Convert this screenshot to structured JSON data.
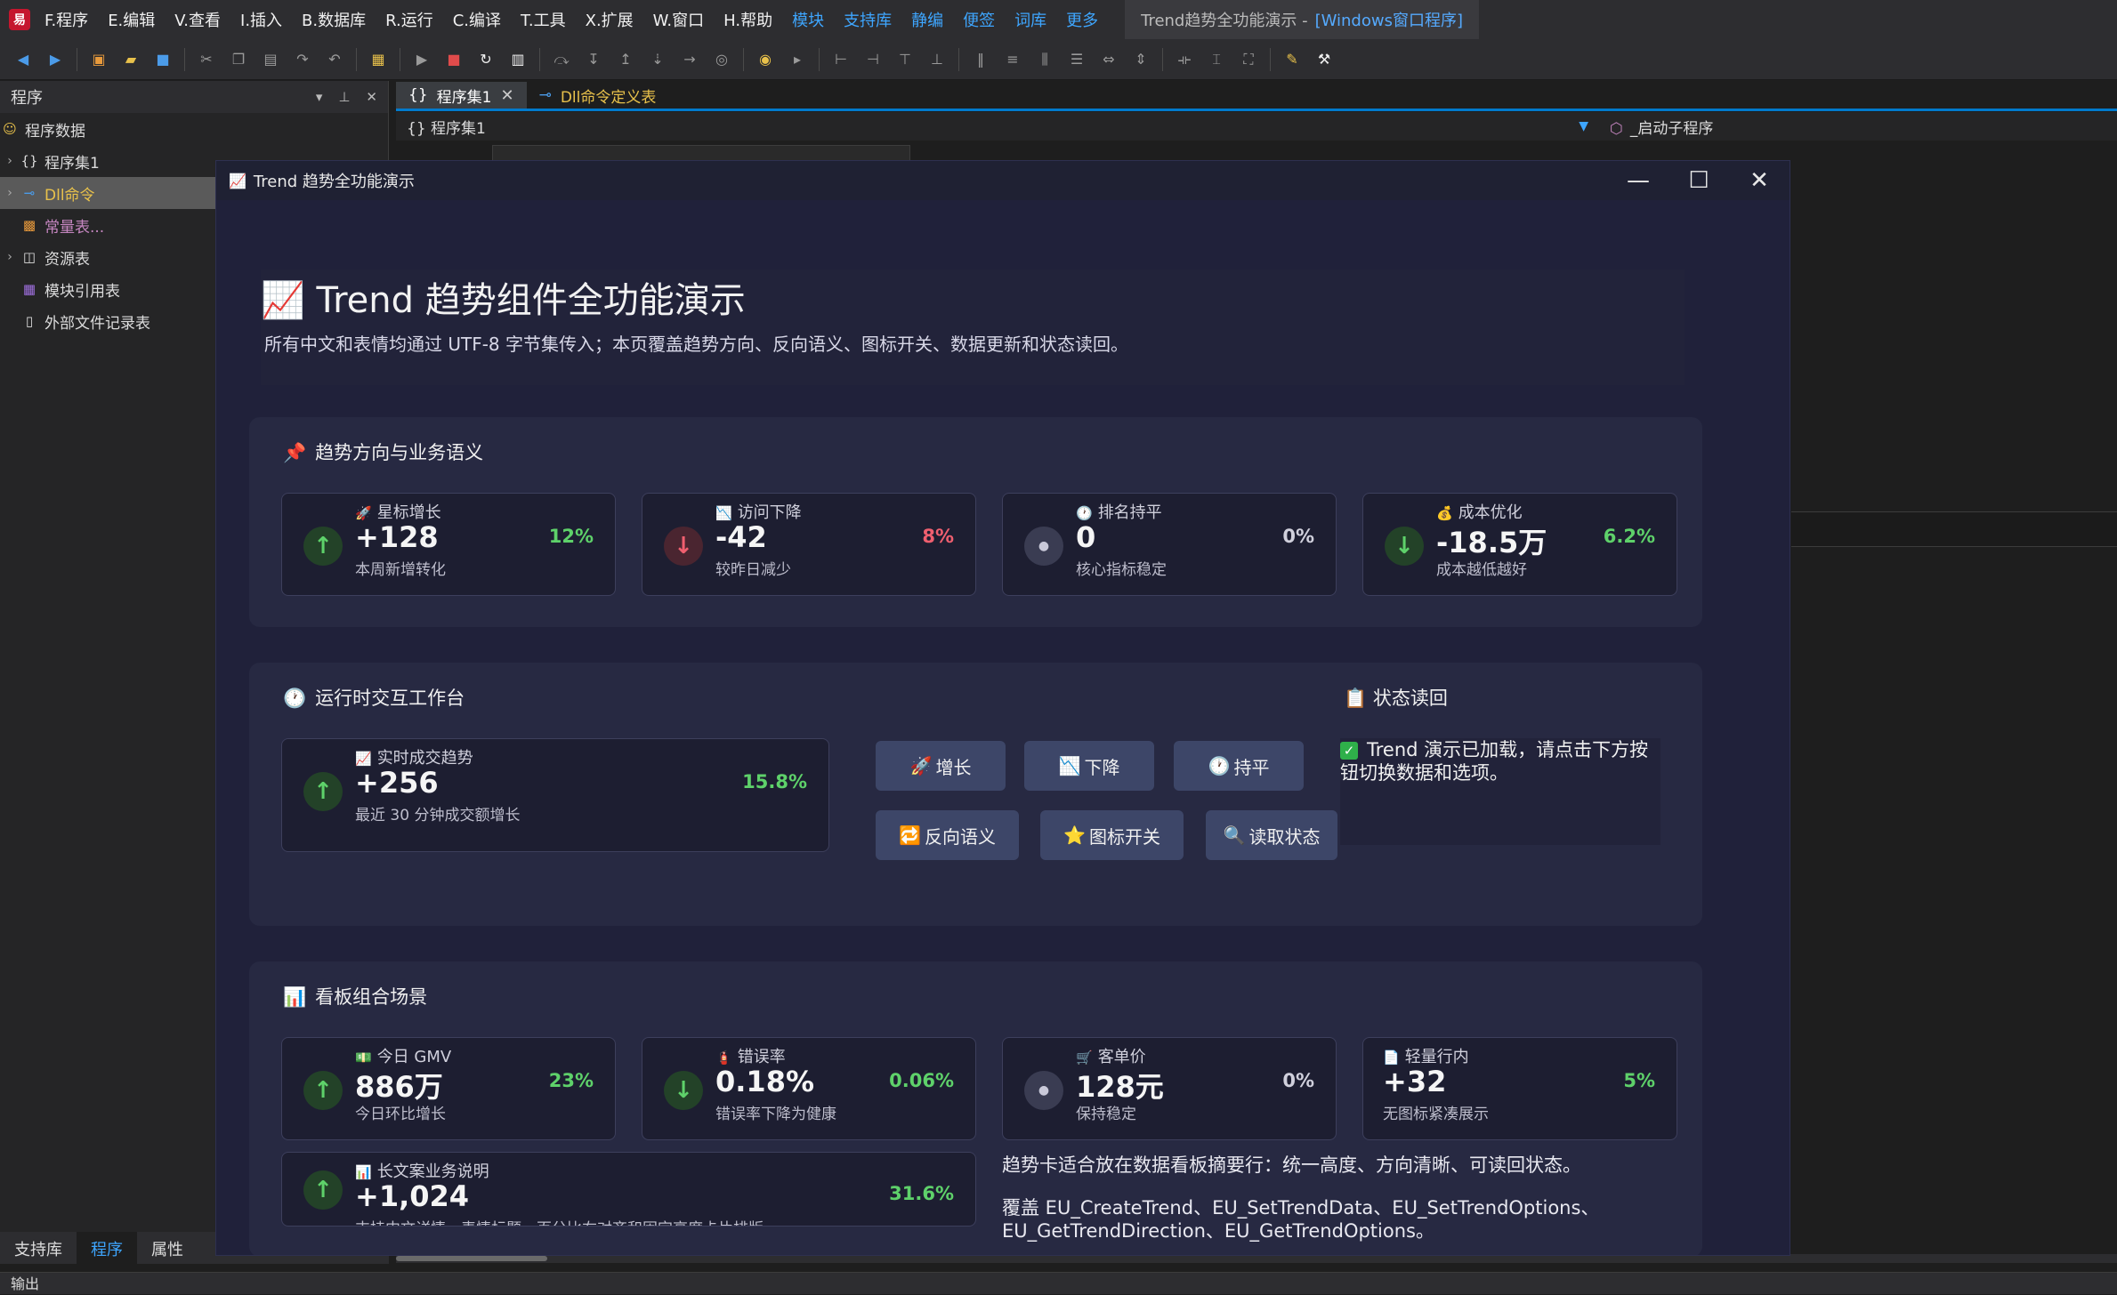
{
  "menubar": {
    "items": [
      "F.程序",
      "E.编辑",
      "V.查看",
      "I.插入",
      "B.数据库",
      "R.运行",
      "C.编译",
      "T.工具",
      "X.扩展",
      "W.窗口",
      "H.帮助"
    ],
    "extras": [
      "模块",
      "支持库",
      "静编",
      "便签",
      "词库",
      "更多"
    ],
    "title_tab": "Trend趋势全功能演示 -",
    "title_highlight": "[Windows窗口程序]"
  },
  "left_pane": {
    "header": "程序",
    "items": [
      {
        "label": "程序数据",
        "icon": "smiley-icon"
      },
      {
        "label": "程序集1",
        "icon": "braces-icon"
      },
      {
        "label": "Dll命令",
        "icon": "link-icon"
      },
      {
        "label": "常量表...",
        "icon": "constant-icon"
      },
      {
        "label": "资源表",
        "icon": "resource-icon"
      },
      {
        "label": "模块引用表",
        "icon": "module-icon"
      },
      {
        "label": "外部文件记录表",
        "icon": "file-icon"
      }
    ],
    "bottom_tabs": [
      "支持库",
      "程序",
      "属性"
    ]
  },
  "output_label": "输出",
  "editor": {
    "tabs": [
      "程序集1",
      "Dll命令定义表"
    ],
    "dropdown": "程序集1",
    "dropdown2": "_启动子程序"
  },
  "window": {
    "title": "Trend 趋势全功能演示",
    "hero_title": "Trend 趋势组件全功能演示",
    "hero_sub": "所有中文和表情均通过 UTF-8 字节集传入；本页覆盖趋势方向、反向语义、图标开关、数据更新和状态读回。"
  },
  "section1": {
    "title": "趋势方向与业务语义",
    "cards": [
      {
        "caption": "星标增长",
        "icon": "🚀",
        "value": "+128",
        "desc": "本周新增转化",
        "pct": "12%",
        "dir": "up",
        "pct_color": "green"
      },
      {
        "caption": "访问下降",
        "icon": "📉",
        "value": "-42",
        "desc": "较昨日减少",
        "pct": "8%",
        "dir": "down",
        "pct_color": "red"
      },
      {
        "caption": "排名持平",
        "icon": "🕐",
        "value": "0",
        "desc": "核心指标稳定",
        "pct": "0%",
        "dir": "flat",
        "pct_color": "gray"
      },
      {
        "caption": "成本优化",
        "icon": "💰",
        "value": "-18.5万",
        "desc": "成本越低越好",
        "pct": "6.2%",
        "dir": "up-down",
        "pct_color": "green"
      }
    ]
  },
  "section2": {
    "title": "运行时交互工作台",
    "card": {
      "caption": "实时成交趋势",
      "icon": "📈",
      "value": "+256",
      "desc": "最近 30 分钟成交额增长",
      "pct": "15.8%"
    },
    "buttons": [
      {
        "label": "增长",
        "icon": "🚀"
      },
      {
        "label": "下降",
        "icon": "📉"
      },
      {
        "label": "持平",
        "icon": "🕐"
      },
      {
        "label": "反向语义",
        "icon": "🔁"
      },
      {
        "label": "图标开关",
        "icon": "⭐"
      },
      {
        "label": "读取状态",
        "icon": "🔍"
      }
    ],
    "status_title": "状态读回",
    "status_text": "Trend 演示已加载，请点击下方按钮切换数据和选项。"
  },
  "section3": {
    "title": "看板组合场景",
    "cards": [
      {
        "caption": "今日 GMV",
        "icon": "💵",
        "value": "886万",
        "desc": "今日环比增长",
        "pct": "23%",
        "dir": "up",
        "pct_color": "green"
      },
      {
        "caption": "错误率",
        "icon": "🧯",
        "value": "0.18%",
        "desc": "错误率下降为健康",
        "pct": "0.06%",
        "dir": "down-good",
        "pct_color": "green"
      },
      {
        "caption": "客单价",
        "icon": "🛒",
        "value": "128元",
        "desc": "保持稳定",
        "pct": "0%",
        "dir": "flat",
        "pct_color": "gray"
      },
      {
        "caption": "轻量行内",
        "icon": "📄",
        "value": "+32",
        "desc": "无图标紧凑展示",
        "pct": "5%",
        "dir": "none",
        "pct_color": "green"
      }
    ],
    "long_card": {
      "caption": "长文案业务说明",
      "icon": "📊",
      "value": "+1,024",
      "desc": "支持中文详情、表情标题、百分比右对齐和固定高度卡片排版",
      "pct": "31.6%"
    },
    "note1": "趋势卡适合放在数据看板摘要行：统一高度、方向清晰、可读回状态。",
    "note2": "覆盖 EU_CreateTrend、EU_SetTrendData、EU_SetTrendOptions、EU_GetTrendDirection、EU_GetTrendOptions。"
  }
}
